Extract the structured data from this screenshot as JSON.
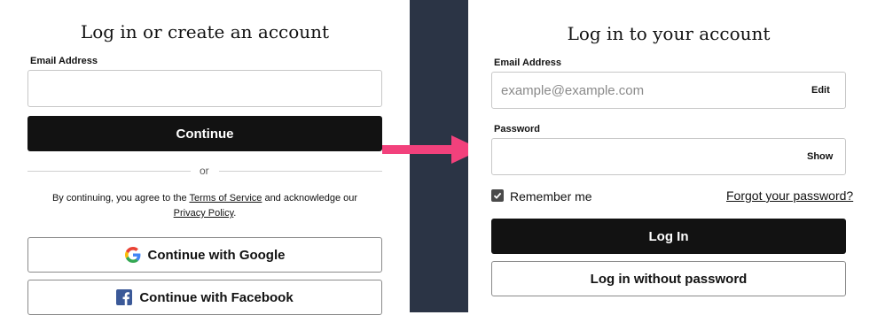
{
  "left": {
    "title": "Log in or create an account",
    "email_label": "Email Address",
    "email_value": "",
    "continue_label": "Continue",
    "or_text": "or",
    "terms_prefix": "By continuing, you agree to the ",
    "terms_link": "Terms of Service",
    "terms_middle": " and acknowledge our",
    "privacy_link": "Privacy Policy",
    "terms_suffix": ".",
    "google_label": "Continue with Google",
    "facebook_label": "Continue with Facebook"
  },
  "right": {
    "title": "Log in to your account",
    "email_label": "Email Address",
    "email_placeholder": "example@example.com",
    "edit_label": "Edit",
    "password_label": "Password",
    "show_label": "Show",
    "remember_label": "Remember me",
    "remember_checked": true,
    "forgot_label": "Forgot your password?",
    "login_label": "Log In",
    "passwordless_label": "Log in without password"
  },
  "colors": {
    "divider": "#2b3445",
    "arrow": "#f2417c",
    "button_dark": "#121212",
    "google_blue": "#4285F4",
    "google_red": "#EA4335",
    "google_yellow": "#FBBC05",
    "google_green": "#34A853",
    "facebook_blue": "#3b5998"
  },
  "icons": {
    "google": "google-icon",
    "facebook": "facebook-icon",
    "checkbox": "checkmark-icon",
    "arrow": "arrow-right-icon"
  }
}
